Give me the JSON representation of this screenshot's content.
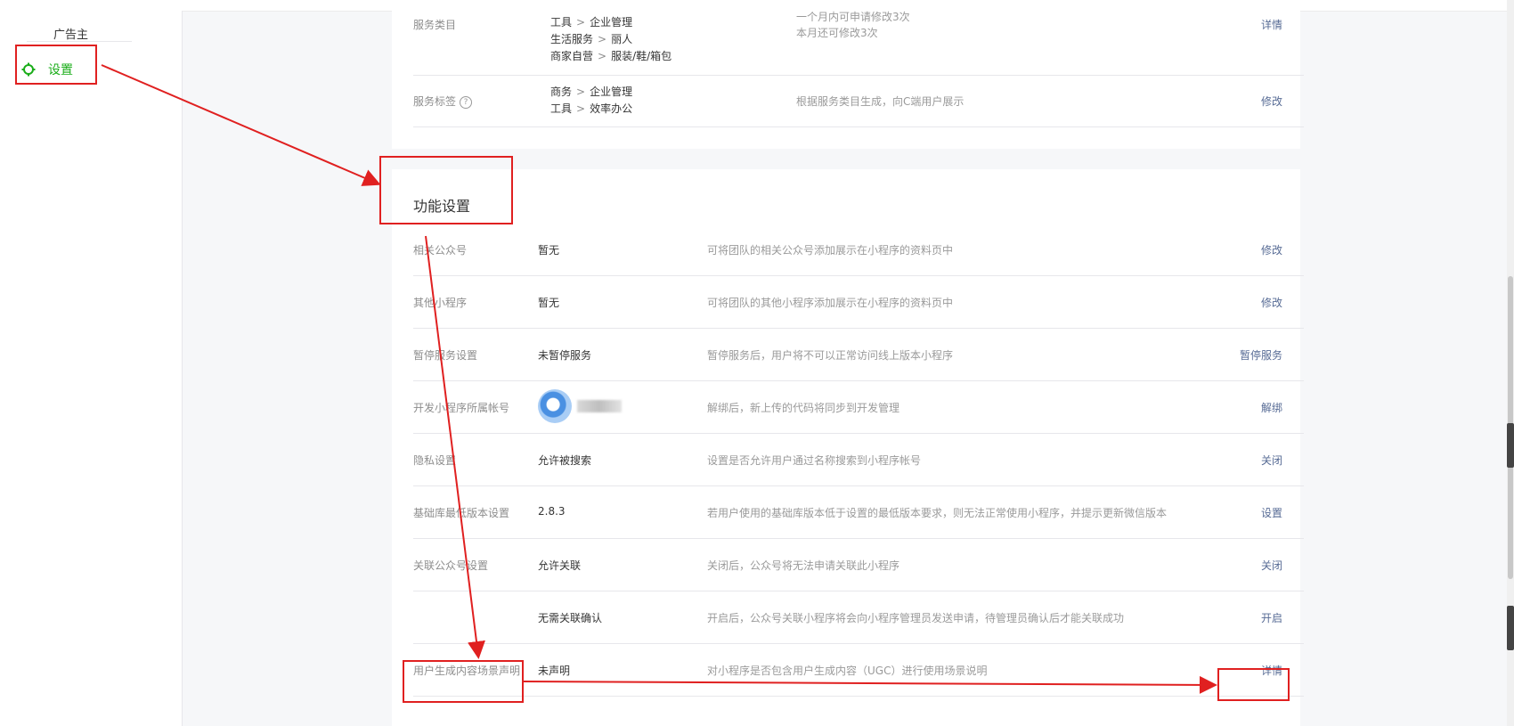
{
  "sidebar": {
    "ad_label": "广告主",
    "settings_label": "设置"
  },
  "service_card": {
    "category_row": {
      "label": "服务类目",
      "lines": [
        {
          "parent": "工具",
          "child": "企业管理"
        },
        {
          "parent": "生活服务",
          "child": "丽人"
        },
        {
          "parent": "商家自营",
          "child": "服装/鞋/箱包"
        }
      ],
      "desc_1": "一个月内可申请修改3次",
      "desc_2": "本月还可修改3次",
      "action": "详情"
    },
    "tag_row": {
      "label": "服务标签",
      "help": "?",
      "lines": [
        {
          "parent": "商务",
          "child": "企业管理"
        },
        {
          "parent": "工具",
          "child": "效率办公"
        }
      ],
      "desc": "根据服务类目生成，向C端用户展示",
      "action": "修改"
    }
  },
  "feature_card": {
    "title": "功能设置",
    "chevron": ">",
    "rows": [
      {
        "label": "相关公众号",
        "value": "暂无",
        "desc": "可将团队的相关公众号添加展示在小程序的资料页中",
        "action": "修改"
      },
      {
        "label": "其他小程序",
        "value": "暂无",
        "desc": "可将团队的其他小程序添加展示在小程序的资料页中",
        "action": "修改"
      },
      {
        "label": "暂停服务设置",
        "value": "未暂停服务",
        "desc": "暂停服务后，用户将不可以正常访问线上版本小程序",
        "action": "暂停服务"
      },
      {
        "label": "开发小程序所属帐号",
        "value": "",
        "desc": "解绑后，新上传的代码将同步到开发管理",
        "action": "解绑"
      },
      {
        "label": "隐私设置",
        "value": "允许被搜索",
        "desc": "设置是否允许用户通过名称搜索到小程序帐号",
        "action": "关闭"
      },
      {
        "label": "基础库最低版本设置",
        "value": "2.8.3",
        "desc": "若用户使用的基础库版本低于设置的最低版本要求，则无法正常使用小程序，并提示更新微信版本",
        "action": "设置"
      },
      {
        "label": "关联公众号设置",
        "value": "允许关联",
        "desc": "关闭后，公众号将无法申请关联此小程序",
        "action": "关闭"
      },
      {
        "label": "",
        "value": "无需关联确认",
        "desc": "开启后，公众号关联小程序将会向小程序管理员发送申请，待管理员确认后才能关联成功",
        "action": "开启"
      },
      {
        "label": "用户生成内容场景声明",
        "value": "未声明",
        "desc": "对小程序是否包含用户生成内容（UGC）进行使用场景说明",
        "action": "详情"
      }
    ]
  },
  "colors": {
    "accent_green": "#1aad19",
    "link_blue": "#576b95",
    "annotation_red": "#e02020"
  }
}
